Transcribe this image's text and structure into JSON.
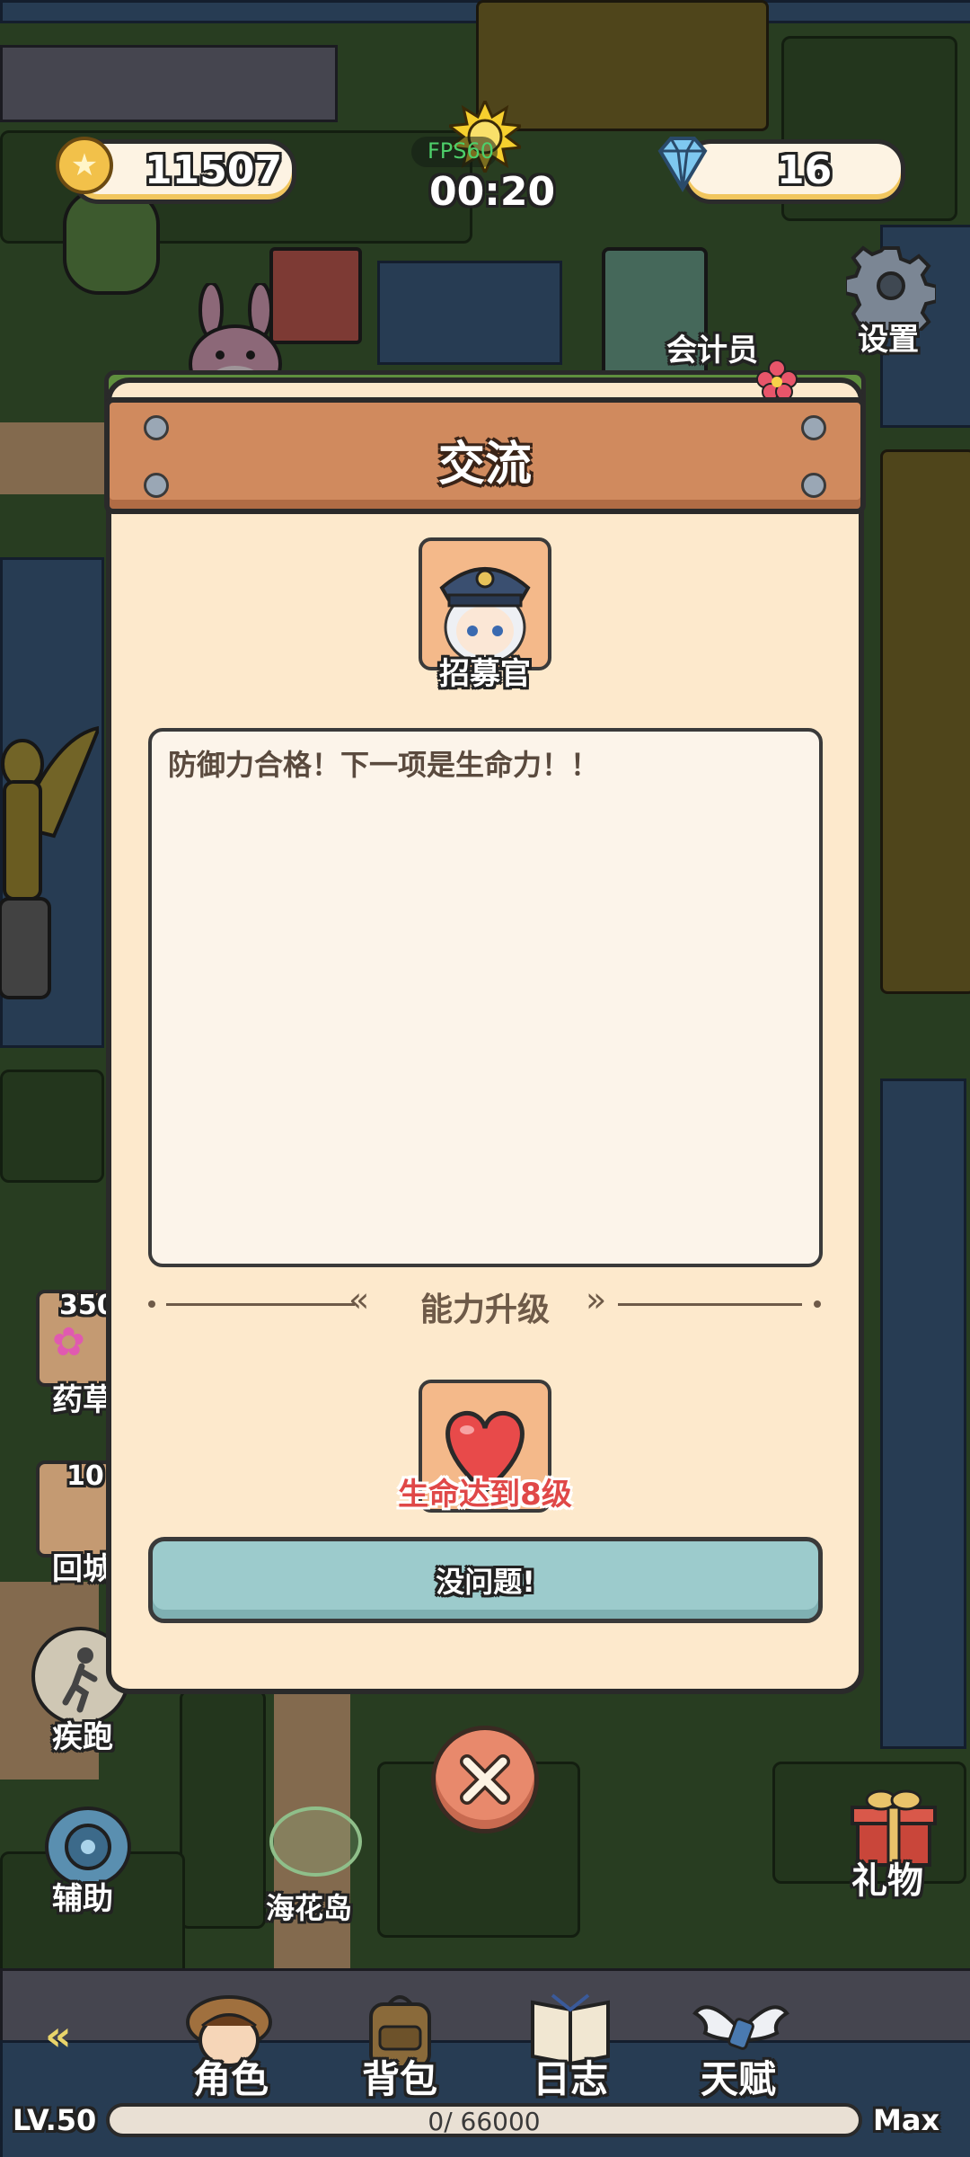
{
  "hud": {
    "coins": "11507",
    "gems": "16",
    "fps_text": "FPS60",
    "timer": "00:20"
  },
  "map_labels": {
    "accountant": "会计员",
    "settings": "设置",
    "herb_count": "350",
    "herb": "药草",
    "return_count": "10",
    "return_city": "回城",
    "sprint": "疾跑",
    "assist": "辅助",
    "island": "海花岛",
    "gift": "礼物"
  },
  "dialog": {
    "title": "交流",
    "npc_name": "招募官",
    "message": "防御力合格！下一项是生命力！！",
    "section_title": "能力升级",
    "requirement": "生命达到8级",
    "confirm_label": "没问题!"
  },
  "bottom_nav": {
    "character": "角色",
    "backpack": "背包",
    "journal": "日志",
    "talent": "天赋"
  },
  "level_bar": {
    "level": "LV.50",
    "xp": "0/ 66000",
    "max": "Max",
    "progress": 0
  },
  "colors": {
    "panel": "#fde9cc",
    "plank": "#d08a5e",
    "button": "#9ccbcc",
    "requirement_text": "#e04848",
    "fps_text": "#4dd06a"
  }
}
